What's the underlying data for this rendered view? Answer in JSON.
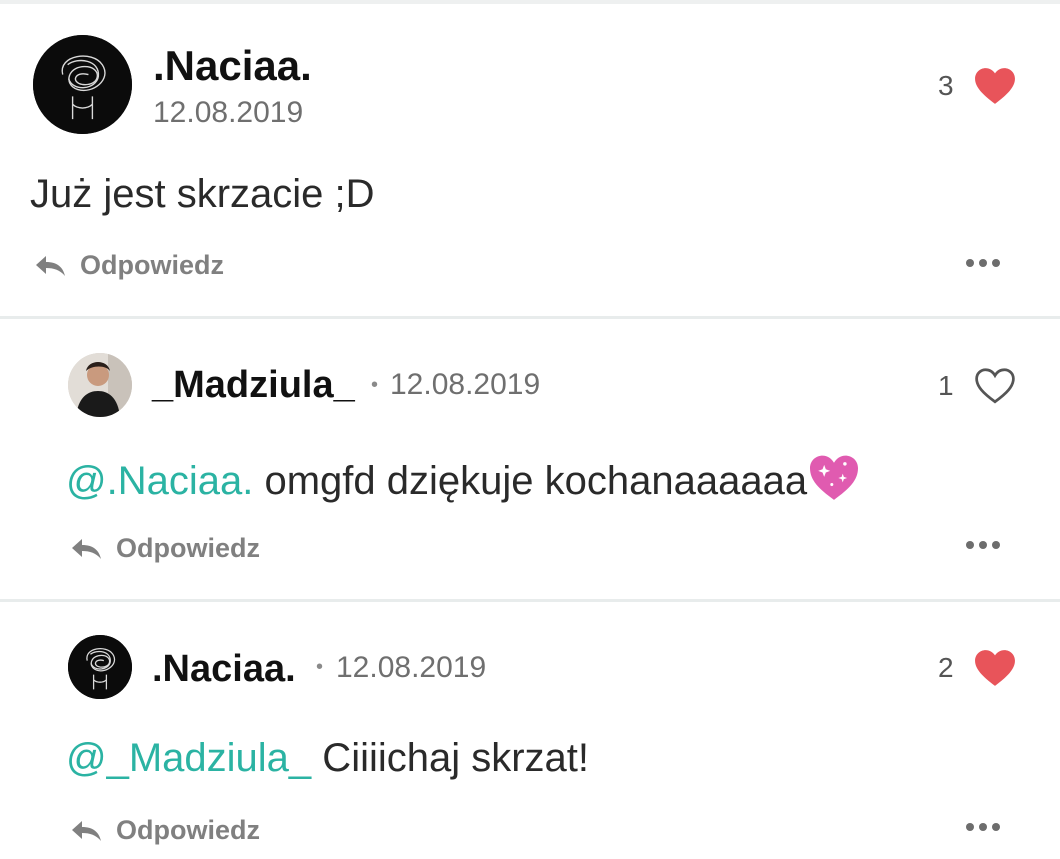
{
  "comments": [
    {
      "username": ".Naciaa.",
      "date": "12.08.2019",
      "likes": "3",
      "liked": true,
      "mention": "",
      "text": "Już jest skrzacie ;D",
      "reply_label": "Odpowiedz"
    },
    {
      "username": "_Madziula_",
      "separator": "•",
      "date": "12.08.2019",
      "likes": "1",
      "liked": false,
      "mention": "@.Naciaa.",
      "text": " omgfd dziękuje kochanaaaaaa",
      "emoji": "sparkling-heart",
      "reply_label": "Odpowiedz"
    },
    {
      "username": ".Naciaa.",
      "separator": "•",
      "date": "12.08.2019",
      "likes": "2",
      "liked": true,
      "mention": "@_Madziula_",
      "text": " Ciiiichaj skrzat!",
      "reply_label": "Odpowiedz"
    }
  ],
  "colors": {
    "heart_filled": "#e8545a",
    "mention": "#2bb3a3",
    "emoji_heart": "#e05bb0"
  }
}
